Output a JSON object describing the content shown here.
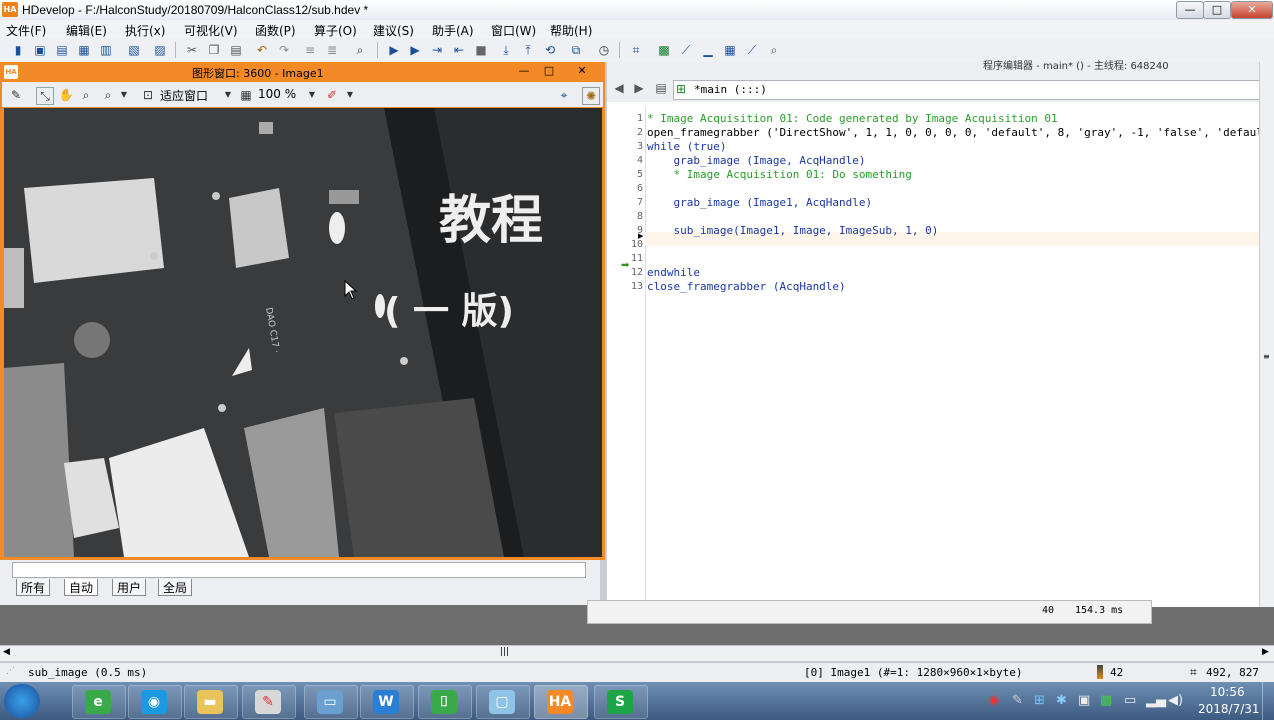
{
  "app": {
    "title": "HDevelop - F:/HalconStudy/20180709/HalconClass12/sub.hdev *",
    "logo": "HA"
  },
  "window_buttons": {
    "minimize": "—",
    "maximize": "□",
    "close": "✕"
  },
  "menu": [
    "文件(F)",
    "编辑(E)",
    "执行(x)",
    "可视化(V)",
    "函数(P)",
    "算子(O)",
    "建议(S)",
    "助手(A)",
    "窗口(W)",
    "帮助(H)"
  ],
  "graphics_window": {
    "title": "图形窗口: 3600 - Image1",
    "fit_label": "适应窗口",
    "zoom_label": "100 %",
    "image_text_1": "教程",
    "image_text_2": "( 一 版)",
    "image_text_3": "DAO C17 ·"
  },
  "var_tabs": [
    "所有",
    "自动",
    "用户",
    "全局"
  ],
  "editor": {
    "window_title": "程序编辑器 - main* () - 主线程: 648240",
    "procedure": "*main (:::)",
    "lines": [
      {
        "n": "1",
        "text": "* Image Acquisition 01: Code generated by Image Acquisition 01",
        "cls": "cm"
      },
      {
        "n": "2",
        "text": "open_framegrabber ('DirectShow', 1, 1, 0, 0, 0, 0, 'default', 8, 'gray', -1, 'false', 'defaul",
        "cls": ""
      },
      {
        "n": "3",
        "text": "while (true)",
        "cls": "kw"
      },
      {
        "n": "4",
        "text": "    grab_image (Image, AcqHandle)",
        "cls": "kw"
      },
      {
        "n": "5",
        "text": "    * Image Acquisition 01: Do something",
        "cls": "cm"
      },
      {
        "n": "6",
        "text": "",
        "cls": ""
      },
      {
        "n": "7",
        "text": "    grab_image (Image1, AcqHandle)",
        "cls": "kw"
      },
      {
        "n": "8",
        "text": "",
        "cls": ""
      },
      {
        "n": "9",
        "text": "    sub_image(Image1, Image, ImageSub, 1, 0)",
        "cls": "kw"
      },
      {
        "n": "10",
        "text": "",
        "cls": ""
      },
      {
        "n": "11",
        "text": "",
        "cls": ""
      },
      {
        "n": "12",
        "text": "endwhile",
        "cls": "kw"
      },
      {
        "n": "13",
        "text": "close_framegrabber (AcqHandle)",
        "cls": "kw"
      }
    ],
    "footer_count": "40",
    "footer_time": "154.3 ms"
  },
  "status": {
    "left": "sub_image (0.5 ms)",
    "image_info": "[0] Image1 (#=1: 1280×960×1×byte)",
    "gray_value": "42",
    "coords": "492, 827"
  },
  "taskbar": {
    "time": "10:56",
    "date": "2018/7/31",
    "apps": [
      "ie-icon",
      "skype-icon",
      "explorer-icon",
      "paint-icon",
      "screen-icon",
      "wps-writer-icon",
      "wps-pdf-icon",
      "notepad-icon",
      "halcon-icon",
      "wps-sheet-icon"
    ],
    "halcon_label": "HA",
    "writer_label": "W",
    "sheet_label": "S"
  },
  "colors": {
    "graphics_frame": "#f48a26",
    "comment": "#2a9d2a",
    "keyword": "#1a37a6"
  }
}
